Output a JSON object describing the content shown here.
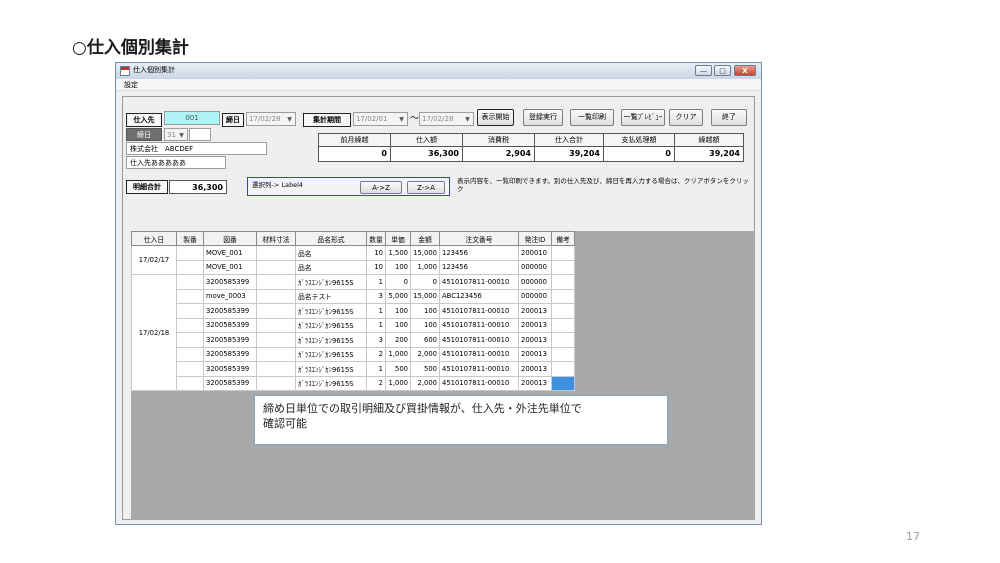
{
  "slide": {
    "title": "○仕入個別集計",
    "page_number": "17"
  },
  "window": {
    "title": "仕入個別集計",
    "controls": {
      "minimize": "—",
      "maximize": "□",
      "close": "X"
    }
  },
  "menu": {
    "settings": "設定"
  },
  "header": {
    "supplier_label": "仕入先",
    "supplier_code": "001",
    "cutoff_label": "締日",
    "cutoff_value": "17/02/28",
    "period_label": "集計期間",
    "period_from": "17/02/01",
    "period_tilde": "〜",
    "period_to": "17/02/28",
    "cutoff_day_label": "締日",
    "cutoff_day_value": "31",
    "company_name": "株式会社　ABCDEF",
    "supplier_name": "仕入先あああああ"
  },
  "buttons": {
    "display_start": "表示開始",
    "register": "登録実行",
    "list_print": "一覧印刷",
    "list_preview": "一覧ﾌﾟﾚﾋﾞｭｰ",
    "clear": "クリア",
    "exit": "終了",
    "sort_asc": "A->Z",
    "sort_desc": "Z->A"
  },
  "summary": {
    "headers": [
      "前月繰越",
      "仕入額",
      "消費税",
      "仕入合計",
      "支払処理額",
      "繰越額"
    ],
    "values": [
      "0",
      "36,300",
      "2,904",
      "39,204",
      "0",
      "39,204"
    ]
  },
  "detail_total": {
    "label": "明細合計",
    "value": "36,300"
  },
  "sort_panel": {
    "label": "選択列-> Label4"
  },
  "note": "表示内容を、一覧印刷できます。別の仕入先及び、締日を再入力する場合は、クリアボタンをクリック",
  "grid": {
    "columns": [
      "仕入日",
      "製番",
      "図番",
      "材料寸法",
      "品名形式",
      "数量",
      "単価",
      "金額",
      "注文番号",
      "発注ID",
      "備考"
    ],
    "rows": [
      [
        "",
        "",
        "MOVE_001",
        "",
        "品名",
        "10",
        "1,500",
        "15,000",
        "123456",
        "200010",
        ""
      ],
      [
        "",
        "",
        "MOVE_001",
        "",
        "品名",
        "10",
        "100",
        "1,000",
        "123456",
        "000000",
        ""
      ],
      [
        "",
        "",
        "3200585399",
        "",
        "ｶﾞﾗｽｴﾝｼﾞｶﾝ9615S",
        "1",
        "0",
        "0",
        "4510107811-00010",
        "000000",
        ""
      ],
      [
        "",
        "",
        "move_0003",
        "",
        "品名テスト",
        "3",
        "5,000",
        "15,000",
        "ABC123456",
        "000000",
        ""
      ],
      [
        "",
        "",
        "3200585399",
        "",
        "ｶﾞﾗｽｴﾝｼﾞｶﾝ9615S",
        "1",
        "100",
        "100",
        "4510107811-00010",
        "200013",
        ""
      ],
      [
        "",
        "",
        "3200585399",
        "",
        "ｶﾞﾗｽｴﾝｼﾞｶﾝ9615S",
        "1",
        "100",
        "100",
        "4510107811-00010",
        "200013",
        ""
      ],
      [
        "",
        "",
        "3200585399",
        "",
        "ｶﾞﾗｽｴﾝｼﾞｶﾝ9615S",
        "3",
        "200",
        "600",
        "4510107811-00010",
        "200013",
        ""
      ],
      [
        "",
        "",
        "3200585399",
        "",
        "ｶﾞﾗｽｴﾝｼﾞｶﾝ9615S",
        "2",
        "1,000",
        "2,000",
        "4510107811-00010",
        "200013",
        ""
      ],
      [
        "",
        "",
        "3200585399",
        "",
        "ｶﾞﾗｽｴﾝｼﾞｶﾝ9615S",
        "1",
        "500",
        "500",
        "4510107811-00010",
        "200013",
        ""
      ],
      [
        "",
        "",
        "3200585399",
        "",
        "ｶﾞﾗｽｴﾝｼﾞｶﾝ9615S",
        "2",
        "1,000",
        "2,000",
        "4510107811-00010",
        "200013",
        ""
      ]
    ],
    "date_groups": [
      {
        "date": "17/02/17",
        "rows": 2
      },
      {
        "date": "17/02/18",
        "rows": 8
      }
    ]
  },
  "callout": {
    "line1": "締め日単位での取引明細及び買掛情報が、仕入先・外注先単位で",
    "line2": "確認可能"
  },
  "colors": {
    "accent_cyan": "#aef4f4",
    "selection_blue": "#3d8fe0",
    "grid_background": "#a9a9a9"
  }
}
